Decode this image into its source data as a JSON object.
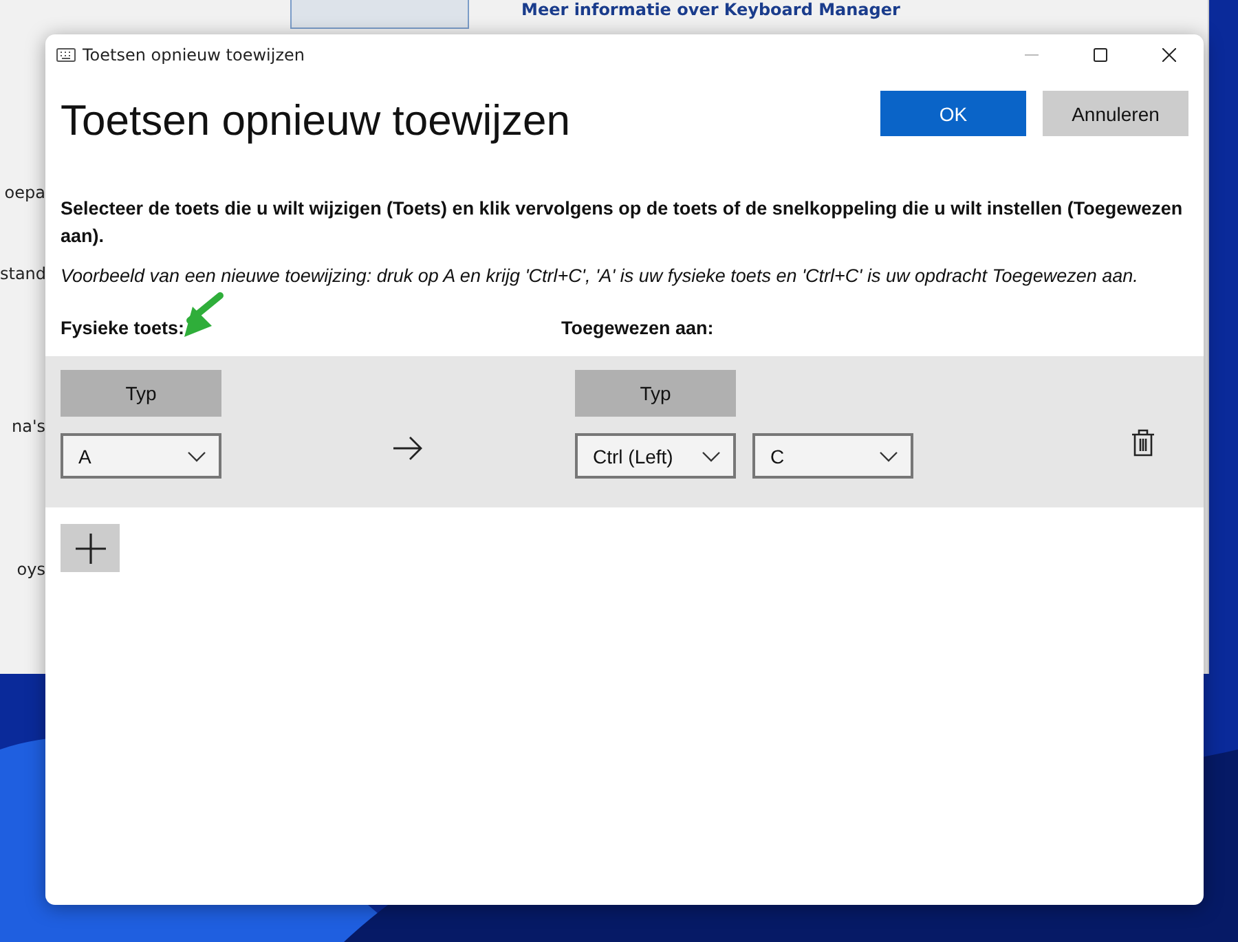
{
  "background_window": {
    "link": "Meer informatie over Keyboard Manager",
    "sidebar_items": [
      {
        "label": "oepa"
      },
      {
        "label": "stand"
      },
      {
        "label": "na's"
      },
      {
        "label": "oys"
      }
    ]
  },
  "dialog": {
    "title": "Toetsen opnieuw toewijzen",
    "heading": "Toetsen opnieuw toewijzen",
    "buttons": [
      {
        "label": "OK",
        "kind": "primary"
      },
      {
        "label": "Annuleren",
        "kind": "secondary"
      }
    ],
    "instructions": "Selecteer de toets die u wilt wijzigen (Toets) en klik vervolgens op de toets of de snelkoppeling die u wilt instellen (Toegewezen aan).",
    "example": "Voorbeeld van een nieuwe toewijzing: druk op A en krijg 'Ctrl+C', 'A' is uw fysieke toets en 'Ctrl+C' is uw opdracht Toegewezen aan.",
    "physical_label": "Fysieke toets:",
    "target_label": "Toegewezen aan:",
    "mappings": [
      {
        "physical": {
          "type_button": "Typ",
          "keys": [
            "A"
          ]
        },
        "target": {
          "type_button": "Typ",
          "keys": [
            "Ctrl (Left)",
            "C"
          ]
        }
      }
    ]
  }
}
